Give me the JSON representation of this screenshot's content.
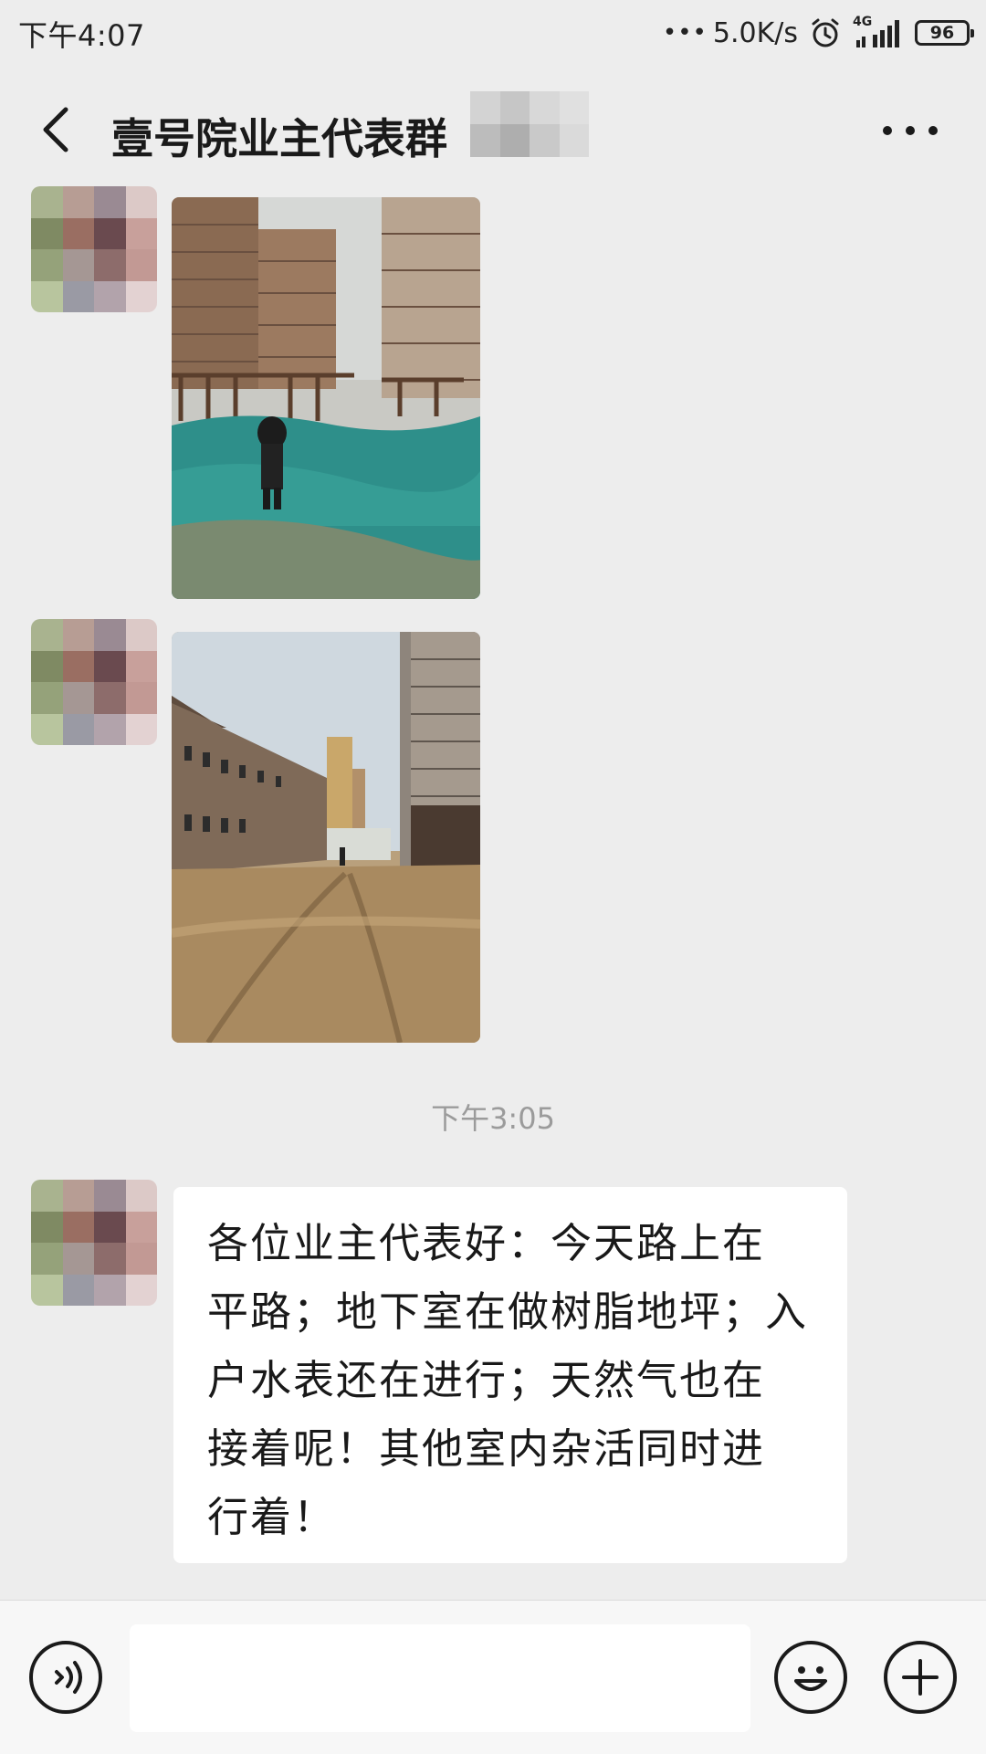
{
  "status_bar": {
    "time": "下午4:07",
    "network_speed": "5.0K/s",
    "network_type": "4G",
    "battery": "96",
    "icons": [
      "more-dots-icon",
      "alarm-icon",
      "signal-icon",
      "battery-icon"
    ]
  },
  "header": {
    "title": "壹号院业主代表群",
    "back_icon": "chevron-left-icon",
    "more_icon": "more-dots-icon"
  },
  "messages": [
    {
      "type": "image",
      "sender_avatar": "pixelated-avatar",
      "content": "photo-construction-site-green-netting"
    },
    {
      "type": "image",
      "sender_avatar": "pixelated-avatar",
      "content": "photo-dirt-road-between-buildings"
    }
  ],
  "timestamp": "下午3:05",
  "text_message": {
    "lines": [
      "各位业主代表好：今天路上在",
      "平路；地下室在做树脂地坪；入",
      "户水表还在进行；天然气也在",
      "接着呢！其他室内杂活同时进",
      "行着！"
    ]
  },
  "input_bar": {
    "voice_icon": "voice-icon",
    "emoji_icon": "emoji-icon",
    "plus_icon": "plus-icon",
    "placeholder": ""
  },
  "colors": {
    "background": "#ededed",
    "bubble": "#ffffff",
    "input_bar": "#f7f7f7",
    "timestamp_text": "#9b9b9b"
  }
}
